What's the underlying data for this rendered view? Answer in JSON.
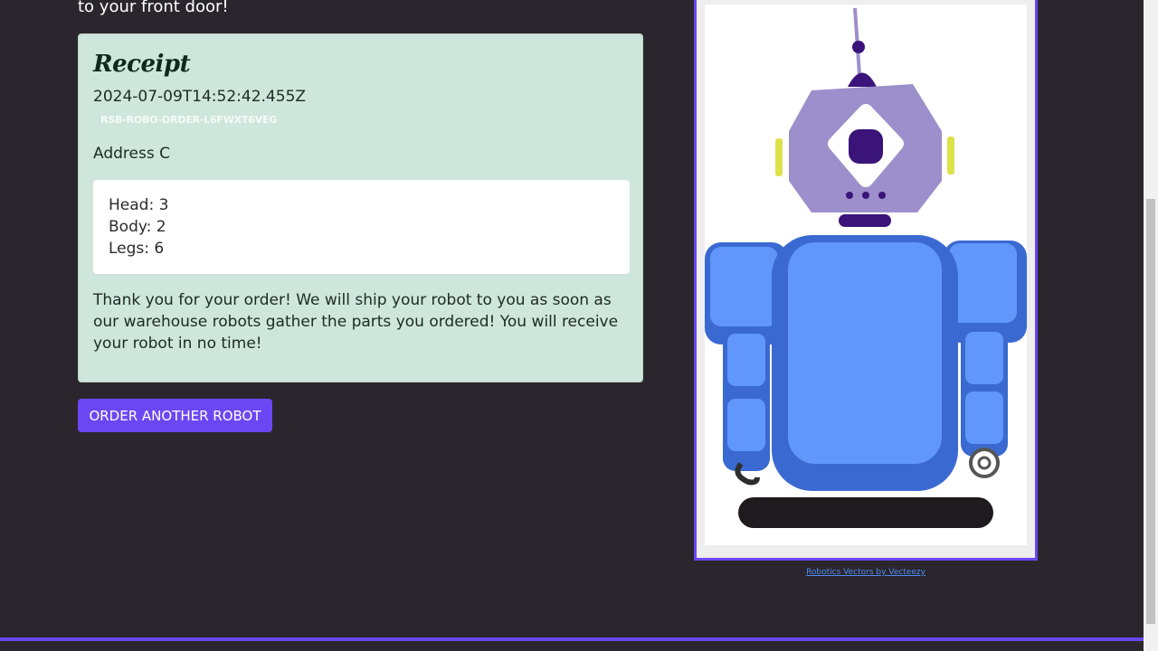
{
  "intro": {
    "text": "to your front door!"
  },
  "receipt": {
    "title": "Receipt",
    "timestamp": "2024-07-09T14:52:42.455Z",
    "order_id": "RSB-ROBO-ORDER-L6FWXT6VEG",
    "address": "Address C",
    "parts": {
      "head": "Head: 3",
      "body": "Body: 2",
      "legs": "Legs: 6"
    },
    "thanks": "Thank you for your order! We will ship your robot to you as soon as our warehouse robots gather the parts you ordered! You will receive your robot in no time!"
  },
  "actions": {
    "order_another": "Order another robot"
  },
  "robot_preview": {
    "credit_link": "Robotics Vectors by Vecteezy"
  },
  "colors": {
    "background": "#2b262d",
    "receipt_bg": "#cfe6dc",
    "accent": "#6b47f3",
    "robot_head": "#9d8fcb",
    "robot_body": "#6196fa",
    "robot_body_dark": "#3a6ad1",
    "robot_dark": "#3a1479"
  }
}
